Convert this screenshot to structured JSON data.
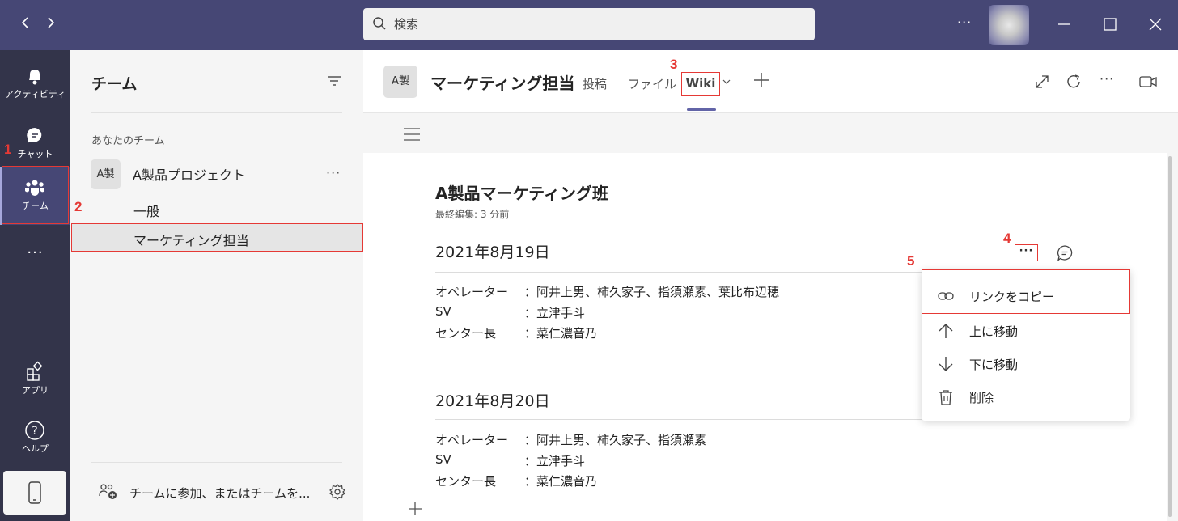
{
  "search": {
    "placeholder": "検索"
  },
  "titlebar": {
    "more": "···"
  },
  "rail": {
    "items": [
      {
        "label": "アクティビティ",
        "icon": "bell-icon"
      },
      {
        "label": "チャット",
        "icon": "chat-icon"
      },
      {
        "label": "チーム",
        "icon": "teams-icon"
      },
      {
        "label": "アプリ",
        "icon": "apps-icon"
      },
      {
        "label": "ヘルプ",
        "icon": "help-icon"
      }
    ],
    "more": "···"
  },
  "teams_pane": {
    "title": "チーム",
    "section": "あなたのチーム",
    "team": {
      "avatar": "A製",
      "name": "A製品プロジェクト",
      "more": "···"
    },
    "channels": [
      "一般",
      "マーケティング担当"
    ],
    "join": "チームに参加、またはチームを..."
  },
  "header": {
    "avatar": "A製",
    "title": "マーケティング担当",
    "tabs": [
      "投稿",
      "ファイル",
      "Wiki"
    ],
    "more": "···"
  },
  "wiki": {
    "title": "A製品マーケティング班",
    "edited": "最終編集: 3 分前",
    "sections": [
      {
        "title": "2021年8月19日",
        "rows": [
          {
            "label": "オペレーター",
            "value": "：阿井上男、柿久家子、指須瀬素、葉比布辺穂"
          },
          {
            "label": "SV",
            "value": "：立津手斗"
          },
          {
            "label": "センター長",
            "value": "：菜仁濃音乃"
          }
        ]
      },
      {
        "title": "2021年8月20日",
        "rows": [
          {
            "label": "オペレーター",
            "value": "：阿井上男、柿久家子、指須瀬素"
          },
          {
            "label": "SV",
            "value": "：立津手斗"
          },
          {
            "label": "センター長",
            "value": "：菜仁濃音乃"
          }
        ]
      }
    ],
    "section_more": "···"
  },
  "context_menu": {
    "items": [
      {
        "label": "リンクをコピー",
        "icon": "link-icon"
      },
      {
        "label": "上に移動",
        "icon": "arrow-up-icon"
      },
      {
        "label": "下に移動",
        "icon": "arrow-down-icon"
      },
      {
        "label": "削除",
        "icon": "trash-icon"
      }
    ]
  },
  "steps": [
    "1",
    "2",
    "3",
    "4",
    "5"
  ],
  "colors": {
    "titlebar": "#464775",
    "rail": "#33344a",
    "accent": "#6264a7",
    "annotation": "#e53935"
  }
}
